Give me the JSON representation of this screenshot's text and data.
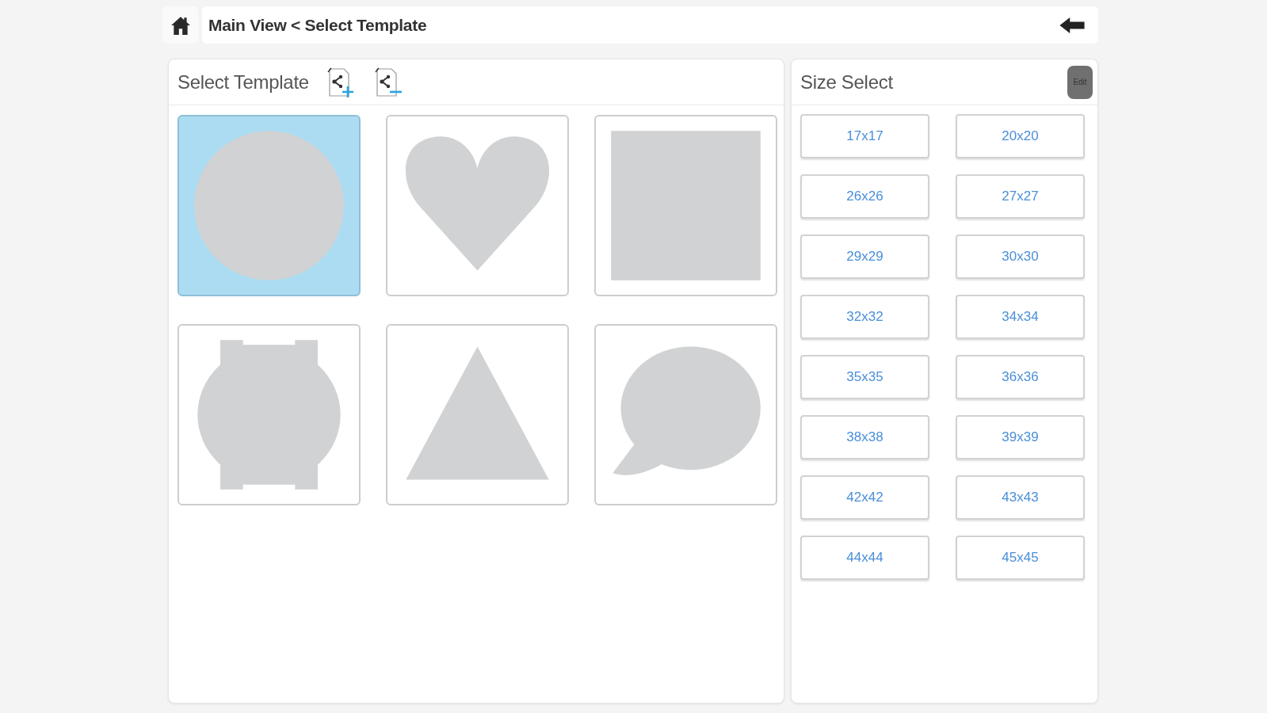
{
  "top_bar": {
    "breadcrumb": "Main View < Select Template"
  },
  "template_panel": {
    "title": "Select Template",
    "templates": [
      {
        "kind": "circle",
        "selected": true
      },
      {
        "kind": "heart",
        "selected": false
      },
      {
        "kind": "square",
        "selected": false
      },
      {
        "kind": "lugged-circle",
        "selected": false
      },
      {
        "kind": "triangle",
        "selected": false
      },
      {
        "kind": "speech-bubble",
        "selected": false
      }
    ]
  },
  "size_panel": {
    "title": "Size Select",
    "edit_button": "Edit",
    "sizes": [
      {
        "label": "17x17",
        "selected": false
      },
      {
        "label": "20x20",
        "selected": false
      },
      {
        "label": "26x26",
        "selected": false
      },
      {
        "label": "27x27",
        "selected": false
      },
      {
        "label": "29x29",
        "selected": false
      },
      {
        "label": "30x30",
        "selected": false
      },
      {
        "label": "32x32",
        "selected": false
      },
      {
        "label": "34x34",
        "selected": false
      },
      {
        "label": "35x35",
        "selected": false
      },
      {
        "label": "36x36",
        "selected": false
      },
      {
        "label": "38x38",
        "selected": false
      },
      {
        "label": "39x39",
        "selected": false
      },
      {
        "label": "42x42",
        "selected": false
      },
      {
        "label": "43x43",
        "selected": false
      },
      {
        "label": "44x44",
        "selected": false
      },
      {
        "label": "45x45",
        "selected": false
      }
    ]
  }
}
